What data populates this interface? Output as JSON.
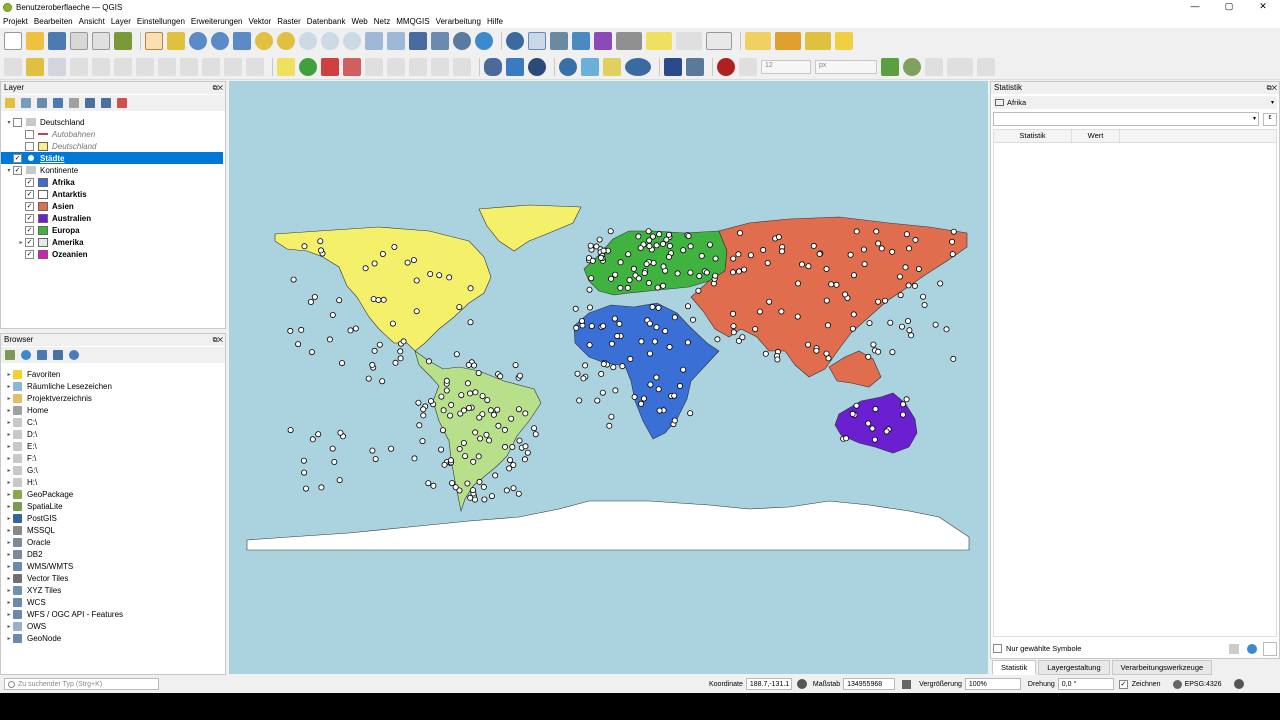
{
  "window": {
    "title": "Benutzeroberflaeche — QGIS",
    "controls": [
      "—",
      "▢",
      "✕"
    ]
  },
  "menu": [
    "Projekt",
    "Bearbeiten",
    "Ansicht",
    "Layer",
    "Einstellungen",
    "Erweiterungen",
    "Vektor",
    "Raster",
    "Datenbank",
    "Web",
    "Netz",
    "MMQGIS",
    "Verarbeitung",
    "Hilfe"
  ],
  "toolbar2": {
    "font_size": "12",
    "unit": "px"
  },
  "layers_panel": {
    "title": "Layer",
    "items": [
      {
        "label": "Deutschland",
        "indent": 0,
        "expand": "▾",
        "checked": false,
        "swatch": "group",
        "selected": false,
        "italic": false,
        "bold": false
      },
      {
        "label": "Autobahnen",
        "indent": 1,
        "expand": "",
        "checked": false,
        "swatch": "line",
        "selected": false,
        "italic": true,
        "bold": false
      },
      {
        "label": "Deutschland",
        "indent": 1,
        "expand": "",
        "checked": false,
        "swatch": "#f8f088",
        "selected": false,
        "italic": true,
        "bold": false
      },
      {
        "label": "Städte",
        "indent": 0,
        "expand": "",
        "checked": true,
        "swatch": "point",
        "selected": true,
        "italic": false,
        "bold": true
      },
      {
        "label": "Kontinente",
        "indent": 0,
        "expand": "▾",
        "checked": true,
        "swatch": "group",
        "selected": false,
        "italic": false,
        "bold": false
      },
      {
        "label": "Afrika",
        "indent": 1,
        "expand": "",
        "checked": true,
        "swatch": "#3a6fd6",
        "selected": false,
        "italic": false,
        "bold": true
      },
      {
        "label": "Antarktis",
        "indent": 1,
        "expand": "",
        "checked": true,
        "swatch": "#ffffff",
        "selected": false,
        "italic": false,
        "bold": true
      },
      {
        "label": "Asien",
        "indent": 1,
        "expand": "",
        "checked": true,
        "swatch": "#e06d4e",
        "selected": false,
        "italic": false,
        "bold": true
      },
      {
        "label": "Australien",
        "indent": 1,
        "expand": "",
        "checked": true,
        "swatch": "#6a1fd0",
        "selected": false,
        "italic": false,
        "bold": true
      },
      {
        "label": "Europa",
        "indent": 1,
        "expand": "",
        "checked": true,
        "swatch": "#3fb23f",
        "selected": false,
        "italic": false,
        "bold": true
      },
      {
        "label": "Amerika",
        "indent": 1,
        "expand": "▸",
        "checked": true,
        "swatch": "#e8e8e8",
        "selected": false,
        "italic": false,
        "bold": true
      },
      {
        "label": "Ozeanien",
        "indent": 1,
        "expand": "",
        "checked": true,
        "swatch": "#d41fb8",
        "selected": false,
        "italic": false,
        "bold": true
      }
    ]
  },
  "browser_panel": {
    "title": "Browser",
    "items": [
      {
        "label": "Favoriten",
        "icon": "star-icon",
        "color": "#f3d230"
      },
      {
        "label": "Räumliche Lesezeichen",
        "icon": "bookmark-icon",
        "color": "#8ab4d8"
      },
      {
        "label": "Projektverzeichnis",
        "icon": "folder-icon",
        "color": "#e0c060"
      },
      {
        "label": "Home",
        "icon": "home-icon",
        "color": "#a0a0a0"
      },
      {
        "label": "C:\\",
        "icon": "drive-icon",
        "color": "#c8c8c8"
      },
      {
        "label": "D:\\",
        "icon": "drive-icon",
        "color": "#c8c8c8"
      },
      {
        "label": "E:\\",
        "icon": "drive-icon",
        "color": "#c8c8c8"
      },
      {
        "label": "F:\\",
        "icon": "drive-icon",
        "color": "#c8c8c8"
      },
      {
        "label": "G:\\",
        "icon": "drive-icon",
        "color": "#c8c8c8"
      },
      {
        "label": "H:\\",
        "icon": "drive-icon",
        "color": "#c8c8c8"
      },
      {
        "label": "GeoPackage",
        "icon": "geopackage-icon",
        "color": "#8aa84a"
      },
      {
        "label": "SpatiaLite",
        "icon": "spatialite-icon",
        "color": "#7a9a5a"
      },
      {
        "label": "PostGIS",
        "icon": "postgis-icon",
        "color": "#336699"
      },
      {
        "label": "MSSQL",
        "icon": "mssql-icon",
        "color": "#888888"
      },
      {
        "label": "Oracle",
        "icon": "oracle-icon",
        "color": "#7a8a9a"
      },
      {
        "label": "DB2",
        "icon": "db2-icon",
        "color": "#7a8a9a"
      },
      {
        "label": "WMS/WMTS",
        "icon": "globe-icon",
        "color": "#6a8aaa"
      },
      {
        "label": "Vector Tiles",
        "icon": "grid-icon",
        "color": "#707070"
      },
      {
        "label": "XYZ Tiles",
        "icon": "grid-icon",
        "color": "#7090b0"
      },
      {
        "label": "WCS",
        "icon": "globe-icon",
        "color": "#6a8aaa"
      },
      {
        "label": "WFS / OGC API - Features",
        "icon": "globe-icon",
        "color": "#6a8aaa"
      },
      {
        "label": "OWS",
        "icon": "globe-icon",
        "color": "#9ab0c8"
      },
      {
        "label": "GeoNode",
        "icon": "geonode-icon",
        "color": "#6a8aaa"
      }
    ]
  },
  "stats_panel": {
    "title": "Statistik",
    "layer": "Afrika",
    "col_statistik": "Statistik",
    "col_wert": "Wert",
    "only_selected": "Nur gewählte Symbole"
  },
  "right_tabs": [
    "Statistik",
    "Layergestaltung",
    "Verarbeitungswerkzeuge"
  ],
  "status": {
    "search_placeholder": "Zu suchender Typ (Strg+K)",
    "coord_label": "Koordinate",
    "coord": "188.7,-131.1",
    "scale_label": "Maßstab",
    "scale": "134955968",
    "magnifier_label": "Vergrößerung",
    "magnifier": "100%",
    "rotation_label": "Drehung",
    "rotation": "0,0 °",
    "render_label": "Zeichnen",
    "crs": "EPSG:4326"
  },
  "colors": {
    "ocean": "#aad3df",
    "africa": "#3a6fd6",
    "asia": "#e06d4e",
    "europe": "#3fb23f",
    "australia": "#6a1fd0",
    "north_america": "#f5f06a",
    "south_america": "#b8e08a",
    "antarctica": "#ffffff",
    "oceania": "#d41fb8",
    "cities": "#ffffff",
    "selection": "#0078d7"
  }
}
